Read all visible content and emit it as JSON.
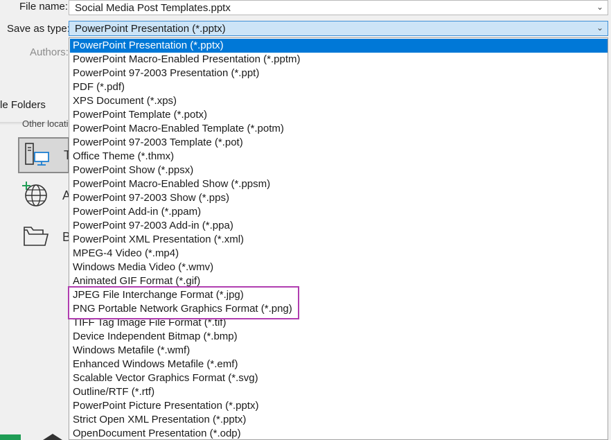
{
  "file_name": {
    "label": "File name:",
    "value": "Social Media Post Templates.pptx"
  },
  "save_as_type": {
    "label": "Save as type:",
    "value": "PowerPoint Presentation (*.pptx)"
  },
  "authors_label": "Authors:",
  "folders_label": "le Folders",
  "other_locations_label": "Other locati",
  "places": [
    {
      "letter": "T",
      "icon": "this-pc-icon"
    },
    {
      "letter": "A",
      "icon": "add-place-globe-icon"
    },
    {
      "letter": "B",
      "icon": "browse-folder-icon"
    }
  ],
  "options": [
    "PowerPoint Presentation (*.pptx)",
    "PowerPoint Macro-Enabled Presentation (*.pptm)",
    "PowerPoint 97-2003 Presentation (*.ppt)",
    "PDF (*.pdf)",
    "XPS Document (*.xps)",
    "PowerPoint Template (*.potx)",
    "PowerPoint Macro-Enabled Template (*.potm)",
    "PowerPoint 97-2003 Template (*.pot)",
    "Office Theme (*.thmx)",
    "PowerPoint Show (*.ppsx)",
    "PowerPoint Macro-Enabled Show (*.ppsm)",
    "PowerPoint 97-2003 Show (*.pps)",
    "PowerPoint Add-in (*.ppam)",
    "PowerPoint 97-2003 Add-in (*.ppa)",
    "PowerPoint XML Presentation (*.xml)",
    "MPEG-4 Video (*.mp4)",
    "Windows Media Video (*.wmv)",
    "Animated GIF Format (*.gif)",
    "JPEG File Interchange Format (*.jpg)",
    "PNG Portable Network Graphics Format (*.png)",
    "TIFF Tag Image File Format (*.tif)",
    "Device Independent Bitmap (*.bmp)",
    "Windows Metafile (*.wmf)",
    "Enhanced Windows Metafile (*.emf)",
    "Scalable Vector Graphics Format (*.svg)",
    "Outline/RTF (*.rtf)",
    "PowerPoint Picture Presentation (*.pptx)",
    "Strict Open XML Presentation (*.pptx)",
    "OpenDocument Presentation (*.odp)"
  ],
  "selected_index": 0,
  "colors": {
    "selection": "#0078d7",
    "annotation": "#b03db0",
    "type_field": "#cce4f7"
  }
}
